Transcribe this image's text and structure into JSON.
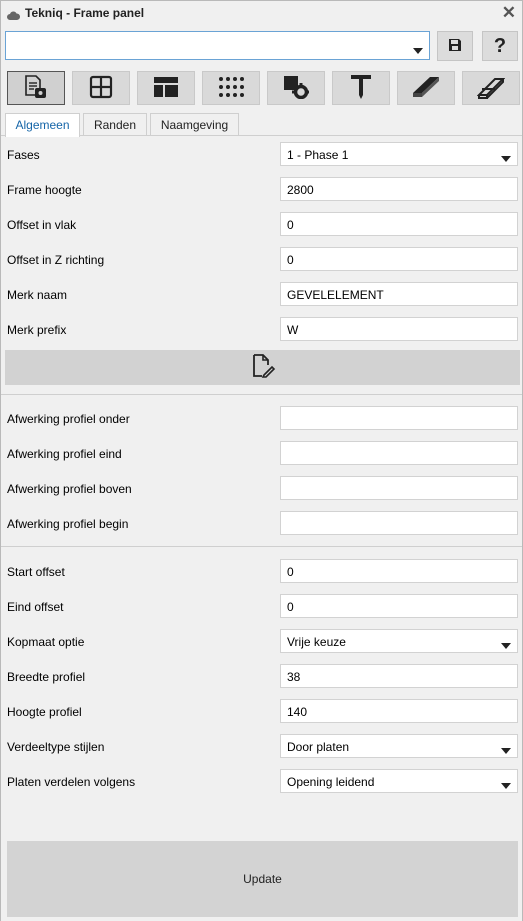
{
  "window": {
    "title": "Tekniq - Frame panel",
    "close_glyph": "✕"
  },
  "top": {
    "preset_value": "",
    "help_glyph": "?"
  },
  "toolbar": {
    "icons": [
      "properties-icon",
      "grid-icon",
      "layout-icon",
      "dots-grid-icon",
      "settings-block-icon",
      "t-profile-icon",
      "beam-icon",
      "stair-profile-icon"
    ]
  },
  "tabs": [
    "Algemeen",
    "Randen",
    "Naamgeving"
  ],
  "form": {
    "fases": {
      "label": "Fases",
      "value": "1 - Phase 1"
    },
    "frame_hoogte": {
      "label": "Frame hoogte",
      "value": "2800"
    },
    "offset_vlak": {
      "label": "Offset in vlak",
      "value": "0"
    },
    "offset_z": {
      "label": "Offset in Z richting",
      "value": "0"
    },
    "merk_naam": {
      "label": "Merk naam",
      "value": "GEVELELEMENT"
    },
    "merk_prefix": {
      "label": "Merk prefix",
      "value": "W"
    },
    "afw_onder": {
      "label": "Afwerking profiel onder",
      "value": ""
    },
    "afw_eind": {
      "label": "Afwerking profiel eind",
      "value": ""
    },
    "afw_boven": {
      "label": "Afwerking profiel boven",
      "value": ""
    },
    "afw_begin": {
      "label": "Afwerking profiel begin",
      "value": ""
    },
    "start_offset": {
      "label": "Start offset",
      "value": "0"
    },
    "eind_offset": {
      "label": "Eind offset",
      "value": "0"
    },
    "kopmaat": {
      "label": "Kopmaat optie",
      "value": "Vrije keuze"
    },
    "breedte": {
      "label": "Breedte profiel",
      "value": "38"
    },
    "hoogte": {
      "label": "Hoogte profiel",
      "value": "140"
    },
    "verdeeltype": {
      "label": "Verdeeltype stijlen",
      "value": "Door platen"
    },
    "platen": {
      "label": "Platen verdelen volgens",
      "value": "Opening leidend"
    }
  },
  "update_label": "Update"
}
